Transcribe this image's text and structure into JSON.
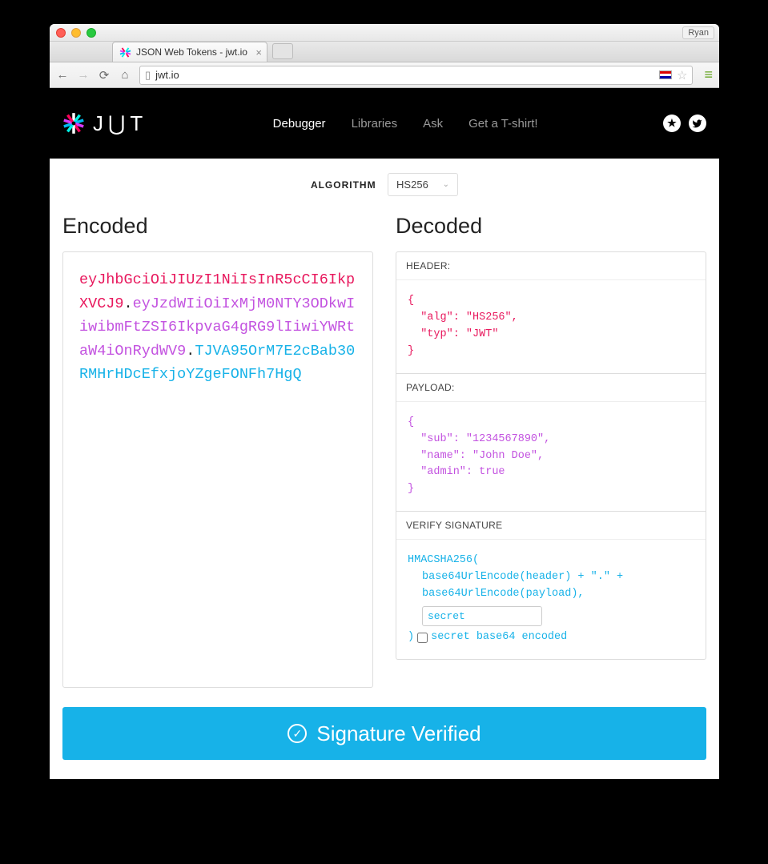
{
  "window": {
    "user": "Ryan"
  },
  "browser": {
    "tab_title": "JSON Web Tokens - jwt.io",
    "url": "jwt.io"
  },
  "nav": {
    "logo_text": "J⋃T",
    "links": [
      "Debugger",
      "Libraries",
      "Ask",
      "Get a T-shirt!"
    ],
    "active_index": 0
  },
  "algorithm": {
    "label": "ALGORITHM",
    "value": "HS256"
  },
  "headings": {
    "encoded": "Encoded",
    "decoded": "Decoded"
  },
  "encoded": {
    "header": "eyJhbGciOiJIUzI1NiIsInR5cCI6IkpXVCJ9",
    "payload": "eyJzdWIiOiIxMjM0NTY3ODkwIiwibmFtZSI6IkpvaG4gRG9lIiwiYWRtaW4iOnRydWV9",
    "signature": "TJVA95OrM7E2cBab30RMHrHDcEfxjoYZgeFONFh7HgQ"
  },
  "decoded": {
    "header_label": "HEADER:",
    "header_json": "{\n  \"alg\": \"HS256\",\n  \"typ\": \"JWT\"\n}",
    "payload_label": "PAYLOAD:",
    "payload_json": "{\n  \"sub\": \"1234567890\",\n  \"name\": \"John Doe\",\n  \"admin\": true\n}",
    "verify_label": "VERIFY SIGNATURE",
    "sig_line1": "HMACSHA256(",
    "sig_line2": "base64UrlEncode(header) + \".\" +",
    "sig_line3": "base64UrlEncode(payload),",
    "sig_secret": "secret",
    "sig_close": ")",
    "sig_checkbox_label": "secret base64 encoded"
  },
  "verify_button": "Signature Verified"
}
